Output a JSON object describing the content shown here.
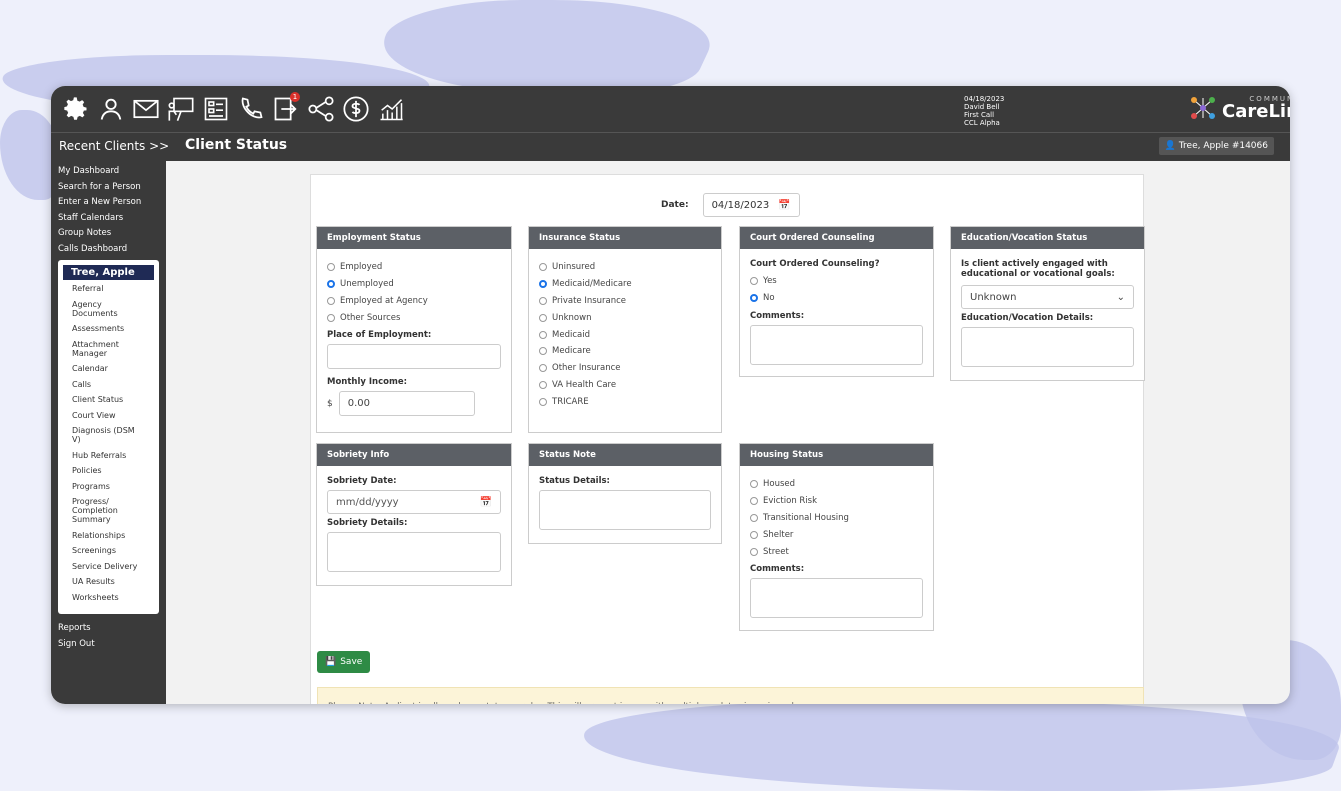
{
  "topbar": {
    "icons": [
      "gear-icon",
      "person-icon",
      "mail-icon",
      "presentation-icon",
      "form-icon",
      "phone-icon",
      "login-icon",
      "share-icon",
      "dollar-icon",
      "chart-icon"
    ],
    "notification_count": "1",
    "user_date": "04/18/2023",
    "user_name": "David Bell",
    "user_role": "First Call",
    "user_org": "CCL Alpha",
    "logo_top": "COMMUNITY",
    "logo_main": "CareLink"
  },
  "subbar": {
    "recent_clients": "Recent Clients >>",
    "page_title": "Client Status",
    "client_badge": "Tree, Apple #14066"
  },
  "sidebar": {
    "top_links": [
      "My Dashboard",
      "Search for a Person",
      "Enter a New Person",
      "Staff Calendars",
      "Group Notes",
      "Calls Dashboard"
    ],
    "client_name": "Tree, Apple",
    "client_links": [
      "Referral",
      "Agency Documents",
      "Assessments",
      "Attachment Manager",
      "Calendar",
      "Calls",
      "Client Status",
      "Court View",
      "Diagnosis (DSM V)",
      "Hub Referrals",
      "Policies",
      "Programs",
      "Progress/ Completion Summary",
      "Relationships",
      "Screenings",
      "Service Delivery",
      "UA Results",
      "Worksheets"
    ],
    "bottom_links": [
      "Reports",
      "Sign Out"
    ]
  },
  "form": {
    "date_label": "Date:",
    "date_value": "04/18/2023",
    "employment": {
      "title": "Employment Status",
      "options": [
        "Employed",
        "Unemployed",
        "Employed at Agency",
        "Other Sources"
      ],
      "place_label": "Place of Employment:",
      "income_label": "Monthly Income:",
      "currency": "$",
      "income_value": "0.00"
    },
    "insurance": {
      "title": "Insurance Status",
      "options": [
        "Uninsured",
        "Medicaid/Medicare",
        "Private Insurance",
        "Unknown",
        "Medicaid",
        "Medicare",
        "Other Insurance",
        "VA Health Care",
        "TRICARE"
      ]
    },
    "court": {
      "title": "Court Ordered Counseling",
      "question": "Court Ordered Counseling?",
      "options": [
        "Yes",
        "No"
      ],
      "comments_label": "Comments:"
    },
    "education": {
      "title": "Education/Vocation Status",
      "question": "Is client actively engaged with educational or vocational goals:",
      "select_value": "Unknown",
      "details_label": "Education/Vocation Details:"
    },
    "sobriety": {
      "title": "Sobriety Info",
      "date_label": "Sobriety Date:",
      "date_placeholder": "mm/dd/yyyy",
      "details_label": "Sobriety Details:"
    },
    "status_note": {
      "title": "Status Note",
      "details_label": "Status Details:"
    },
    "housing": {
      "title": "Housing Status",
      "options": [
        "Housed",
        "Eviction Risk",
        "Transitional Housing",
        "Shelter",
        "Street"
      ],
      "comments_label": "Comments:"
    },
    "save_label": "Save",
    "note": "Please Note: A client is allowed one status per day. This will prevent issues with multiple updates in a given day."
  },
  "accent_colors": {
    "save": "#2e8b45",
    "radio": "#1a73e8",
    "client_name_bg": "#1f2a55"
  }
}
